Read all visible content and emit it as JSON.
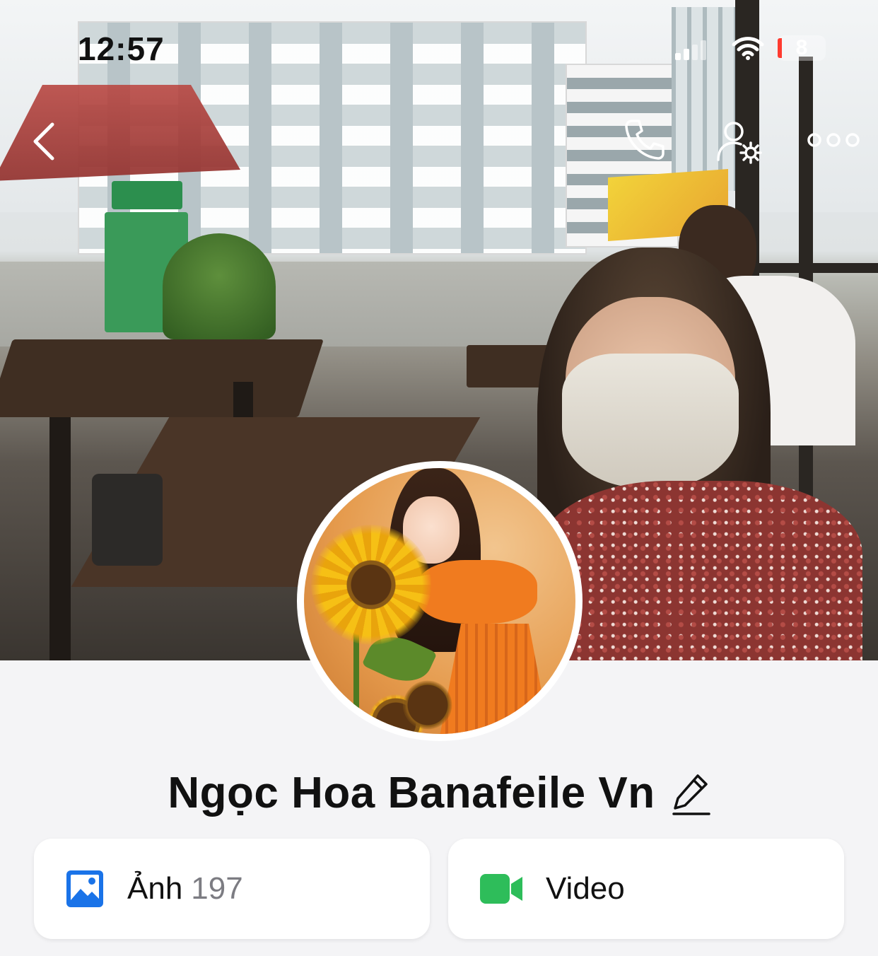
{
  "status_bar": {
    "time": "12:57",
    "battery": "8"
  },
  "nav": {
    "back_icon": "chevron-left-icon",
    "call_icon": "phone-icon",
    "settings_icon": "user-settings-icon",
    "more_icon": "more-icon"
  },
  "profile": {
    "name": "Ngọc Hoa Banafeile Vn",
    "edit_icon": "pencil-icon"
  },
  "media": {
    "photos": {
      "label": "Ảnh",
      "count": "197",
      "icon": "image-icon",
      "color": "#1a73e8"
    },
    "videos": {
      "label": "Video",
      "icon": "video-camera-icon",
      "color": "#2ebd5a"
    }
  },
  "colors": {
    "background": "#f4f4f6",
    "card": "#ffffff",
    "text": "#111111",
    "muted": "#7c7c82",
    "battery_low": "#ff3b30"
  }
}
